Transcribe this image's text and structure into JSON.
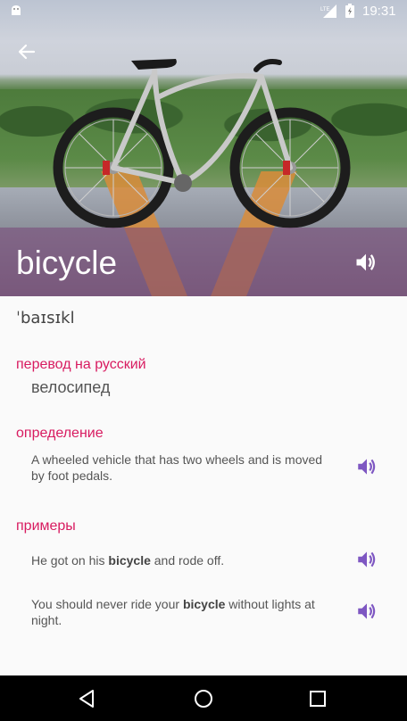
{
  "status_bar": {
    "time": "19:31",
    "network": "LTE",
    "icons": [
      "android-icon",
      "lte-signal-icon",
      "battery-icon"
    ]
  },
  "header": {
    "word": "bicycle",
    "back_icon": "arrow-left-icon",
    "speaker_icon": "speaker-icon"
  },
  "transcription": "ˈbaɪsɪkl",
  "translation": {
    "label": "перевод на русский",
    "value": "велосипед"
  },
  "definition": {
    "label": "определение",
    "text": "A wheeled vehicle that has two wheels and is moved by foot pedals."
  },
  "examples": {
    "label": "примеры",
    "items": [
      {
        "before": "He got on his ",
        "highlight": "bicycle",
        "after": " and rode off."
      },
      {
        "before": "You should never ride your ",
        "highlight": "bicycle",
        "after": " without lights at night."
      }
    ]
  },
  "nav_bar": {
    "icons": [
      "back-triangle-icon",
      "home-circle-icon",
      "recents-square-icon"
    ]
  },
  "colors": {
    "accent": "#d81b60",
    "speaker": "#7e57c2",
    "title_shade": "#78467880"
  }
}
